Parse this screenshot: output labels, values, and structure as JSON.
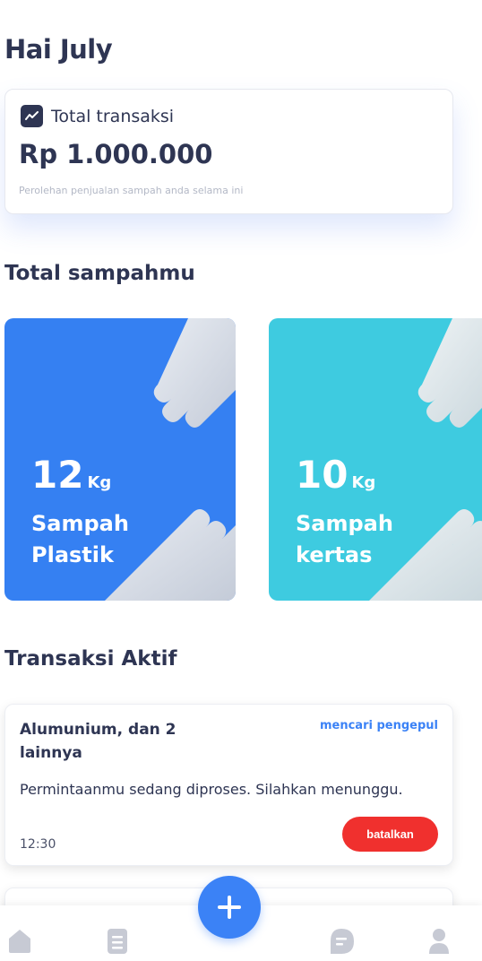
{
  "header": {
    "greeting": "Hai July"
  },
  "summary": {
    "icon": "trend-chart-icon",
    "label": "Total transaksi",
    "amount": "Rp 1.000.000",
    "caption": "Perolehan penjualan sampah anda selama ini"
  },
  "waste_section": {
    "title": "Total sampahmu",
    "cards": [
      {
        "amount": "12",
        "unit": "Kg",
        "label": "Sampah Plastik",
        "color": "#3580f2"
      },
      {
        "amount": "10",
        "unit": "Kg",
        "label": "Sampah kertas",
        "color": "#3ecbe0"
      }
    ]
  },
  "transactions": {
    "title": "Transaksi Aktif",
    "items": [
      {
        "title": "Alumunium, dan 2 lainnya",
        "status": "mencari pengepul",
        "message": "Permintaanmu sedang diproses. Silahkan menunggu.",
        "time": "12:30",
        "action": "batalkan"
      }
    ]
  },
  "bottom_nav": {
    "items": [
      "home-icon",
      "document-icon",
      "add-icon",
      "chat-icon",
      "profile-icon"
    ]
  },
  "colors": {
    "primary": "#3b82f6",
    "text": "#2e3553",
    "danger": "#f0302e"
  }
}
